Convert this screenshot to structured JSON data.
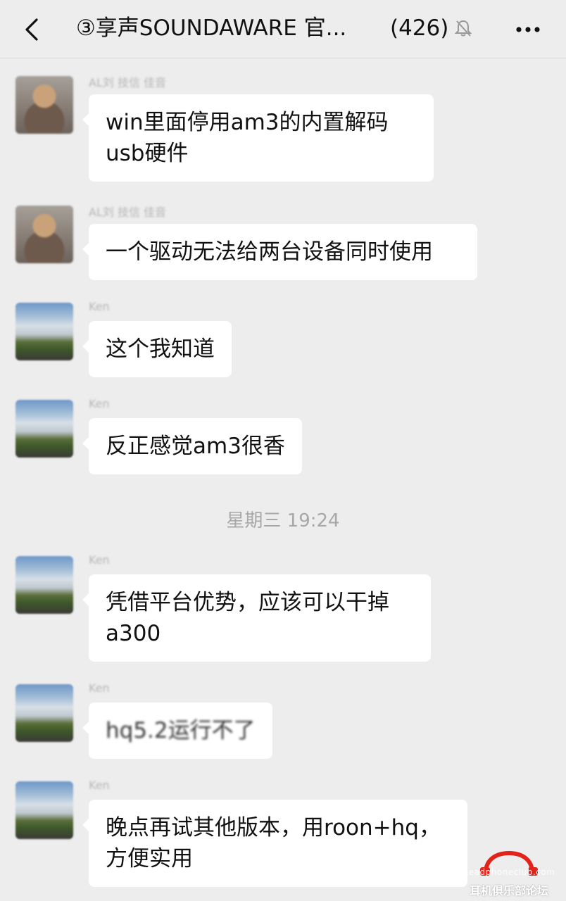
{
  "header": {
    "title": "③享声SOUNDAWARE 官...",
    "member_count": "(426)",
    "back_icon": "chevron-left-icon",
    "mute_icon": "bell-off-icon",
    "more_icon": "more-dots-icon"
  },
  "messages": [
    {
      "sender": "AL刘 技信 佳音",
      "avatar": "person",
      "text": "win里面停用am3的内置解码usb硬件"
    },
    {
      "sender": "AL刘 技信 佳音",
      "avatar": "person",
      "text": "一个驱动无法给两台设备同时使用"
    },
    {
      "sender": "Ken",
      "avatar": "scene",
      "text": "这个我知道"
    },
    {
      "sender": "Ken",
      "avatar": "scene",
      "text": "反正感觉am3很香"
    },
    {
      "sender": "Ken",
      "avatar": "scene",
      "text": "凭借平台优势，应该可以干掉a300"
    },
    {
      "sender": "Ken",
      "avatar": "scene",
      "text": "hq5.2运行不了"
    },
    {
      "sender": "Ken",
      "avatar": "scene",
      "text": "晚点再试其他版本，用roon+hq，方便实用"
    }
  ],
  "timestamp": "星期三 19:24",
  "watermark": {
    "line1": "headphoneclub.com",
    "line2": "耳机俱乐部论坛"
  }
}
